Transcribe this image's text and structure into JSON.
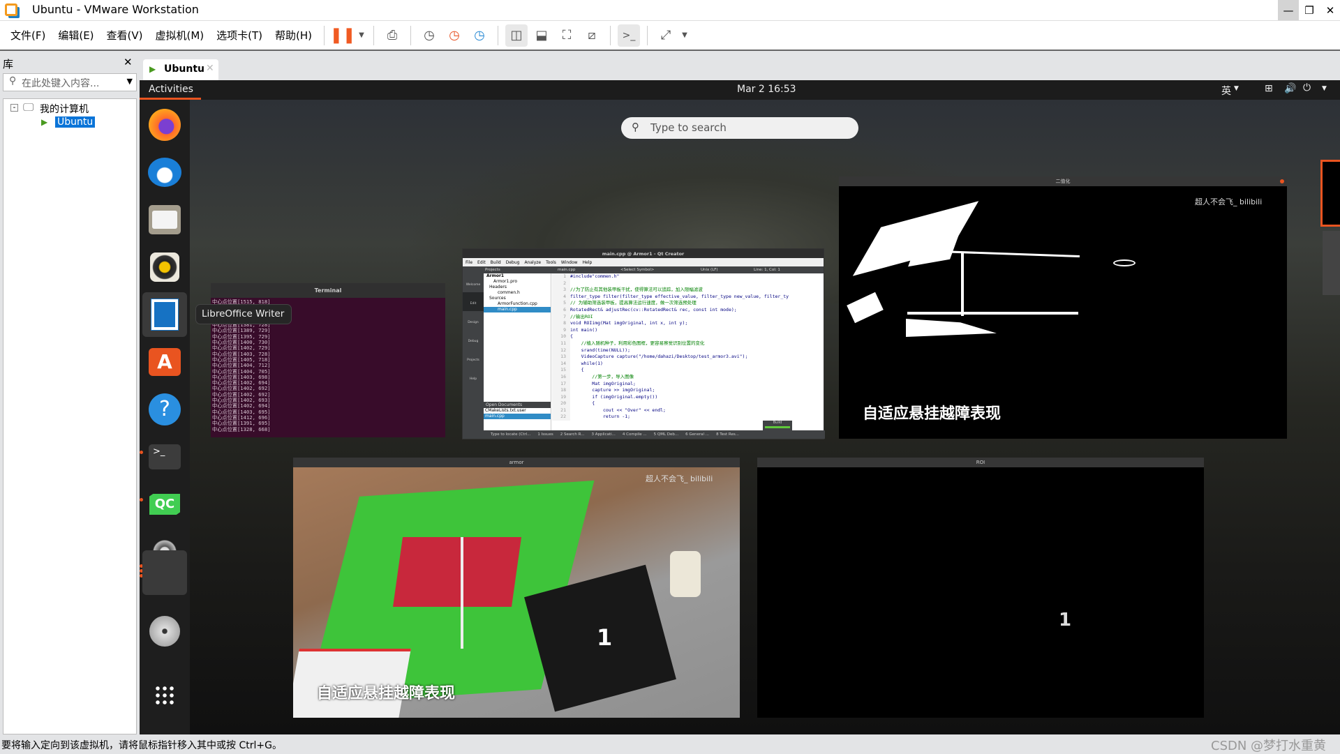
{
  "window": {
    "title": "Ubuntu - VMware Workstation",
    "controls": [
      "minimize",
      "restore",
      "close"
    ]
  },
  "menubar": {
    "items": [
      "文件(F)",
      "编辑(E)",
      "查看(V)",
      "虚拟机(M)",
      "选项卡(T)",
      "帮助(H)"
    ],
    "toolbar_icons": [
      "pause-icon",
      "send-ctrl-alt-del-icon",
      "snapshot-take-icon",
      "snapshot-revert-icon",
      "snapshot-manager-icon",
      "library-view-icon",
      "thumbnail-view-icon",
      "fullscreen-icon",
      "unity-icon",
      "console-icon",
      "stretch-icon"
    ]
  },
  "library": {
    "title": "库",
    "search_placeholder": "在此处键入内容...",
    "tree": {
      "root": "我的计算机",
      "child": "Ubuntu"
    }
  },
  "tab": {
    "label": "Ubuntu"
  },
  "ubuntu": {
    "activities": "Activities",
    "clock": "Mar 2  16:53",
    "input_method": "英",
    "search_placeholder": "Type to search",
    "tooltip": "LibreOffice Writer",
    "dock": [
      "Firefox",
      "Thunderbird",
      "Files",
      "Rhythmbox",
      "LibreOffice Writer",
      "Ubuntu Software",
      "Help",
      "Terminal",
      "Qt Creator",
      "Videos",
      "Running app",
      "DVD",
      "Show Applications"
    ],
    "accent": "#e95420",
    "terminal": {
      "title": "Terminal",
      "lines": [
        "中心点位置[1515, 818]",
        "中心点位置[1500, 810]",
        "中心点位置[1450, 760]",
        "中心点位置[1400, 740]",
        "中心点位置[1381, 728]",
        "中心点位置[1389, 729]",
        "中心点位置[1395, 729]",
        "中心点位置[1400, 730]",
        "中心点位置[1402, 729]",
        "中心点位置[1403, 728]",
        "中心点位置[1405, 718]",
        "中心点位置[1404, 712]",
        "中心点位置[1404, 705]",
        "中心点位置[1403, 698]",
        "中心点位置[1402, 694]",
        "中心点位置[1402, 692]",
        "中心点位置[1402, 692]",
        "中心点位置[1402, 693]",
        "中心点位置[1402, 694]",
        "中心点位置[1403, 695]",
        "中心点位置[1412, 696]",
        "中心点位置[1391, 695]",
        "中心点位置[1328, 668]"
      ]
    },
    "qt": {
      "title": "main.cpp @ Armor1 - Qt Creator",
      "menu": [
        "File",
        "Edit",
        "Build",
        "Debug",
        "Analyze",
        "Tools",
        "Window",
        "Help"
      ],
      "bar": {
        "projects": "Projects",
        "file": "main.cpp",
        "symbol": "<Select Symbol>",
        "eol": "Unix (LF)",
        "pos": "Line: 1, Col: 1"
      },
      "modes": [
        "Welcome",
        "Edit",
        "Design",
        "Debug",
        "Projects",
        "Help"
      ],
      "tree": [
        "Armor1",
        "Armor1.pro",
        "Headers",
        "commen.h",
        "Sources",
        "ArmorFunction.cpp",
        "main.cpp"
      ],
      "open_docs_title": "Open Documents",
      "open_docs": [
        "CMakeLists.txt.user",
        "main.cpp"
      ],
      "code": [
        "#include\"commen.h\"",
        "",
        "//为了防止有其他装甲板干扰，使得算法可以追踪，加入限幅滤波",
        "filter_type filter(filter_type effective_value, filter_type new_value, filter_ty",
        "// 为辅助筛选装甲板，提高算法运行速度，做一次筛选预处理",
        "RotatedRect& adjustRec(cv::RotatedRect& rec, const int mode);",
        "//输出ROI",
        "void ROIimg(Mat imgOriginal, int x, int y);",
        "int main()",
        "{",
        "    //植入随机种子，利用彩色图框，更容易察觉识别位置的变化",
        "    srand(time(NULL));",
        "    VideoCapture capture(\"/home/dahazi/Desktop/test_armor3.avi\");",
        "    while(1)",
        "    {",
        "        //第一步，导入图像",
        "        Mat imgOriginal;",
        "        capture >> imgOriginal;",
        "        if (imgOriginal.empty())",
        "        {",
        "            cout << \"Over\" << endl;",
        "            return -1;"
      ],
      "status": [
        "Type to locate (Ctrl...",
        "1 Issues",
        "2 Search R...",
        "3 Applicati...",
        "4 Compile ...",
        "5 QML Deb...",
        "6 General ...",
        "8 Test Res..."
      ],
      "build_label": "Build"
    },
    "windows": {
      "binary": {
        "title": "二值化",
        "watermark": "超人不会飞_ bilibili",
        "caption": "自适应悬挂越障表现"
      },
      "armor": {
        "title": "armor",
        "watermark": "超人不会飞_ bilibili",
        "caption": "自适应悬挂越障表现"
      },
      "roi": {
        "title": "ROI",
        "digit": "1"
      }
    }
  },
  "statusbar": {
    "text": "要将输入定向到该虚拟机，请将鼠标指针移入其中或按 Ctrl+G。",
    "watermark": "CSDN @梦打水重黄"
  }
}
